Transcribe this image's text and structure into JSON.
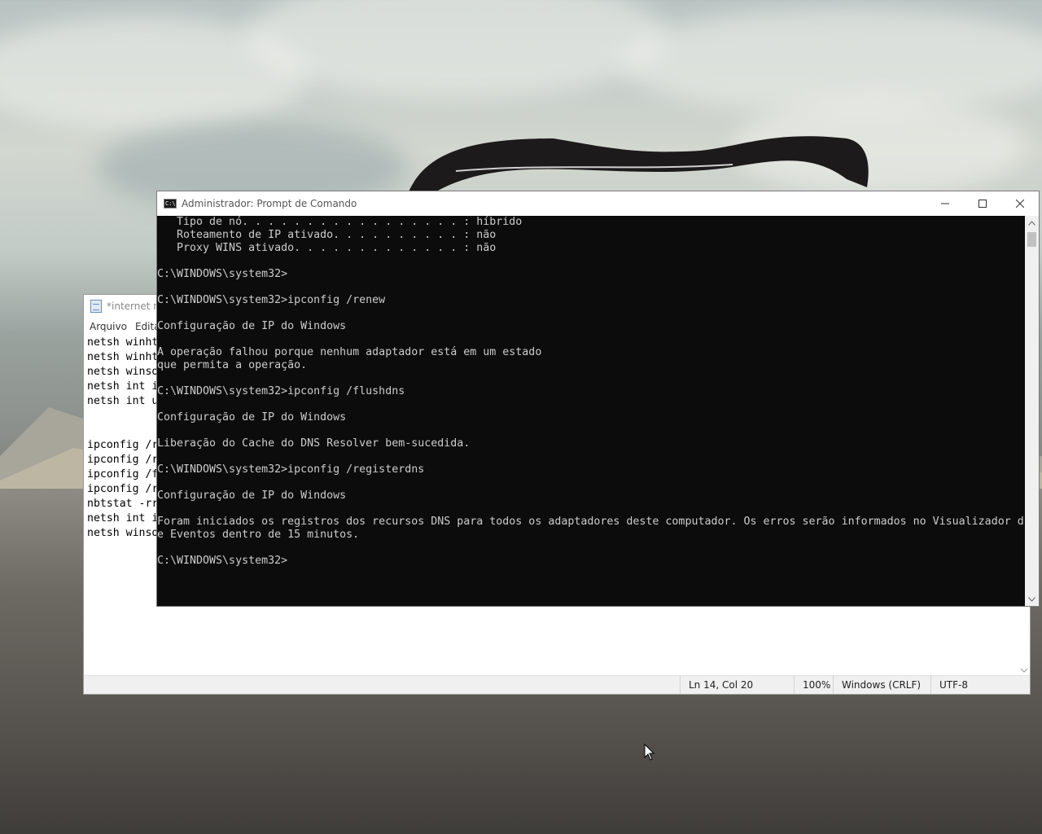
{
  "cmd_window": {
    "title": "Administrador: Prompt de Comando",
    "icon_text": "C:\\.",
    "lines": [
      "   Tipo de nó. . . . . . . . . . . . . . . . . : híbrido",
      "   Roteamento de IP ativado. . . . . . . . . . : não",
      "   Proxy WINS ativado. . . . . . . . . . . . . : não",
      "",
      "C:\\WINDOWS\\system32>",
      "",
      "C:\\WINDOWS\\system32>ipconfig /renew",
      "",
      "Configuração de IP do Windows",
      "",
      "A operação falhou porque nenhum adaptador está em um estado",
      "que permita a operação.",
      "",
      "C:\\WINDOWS\\system32>ipconfig /flushdns",
      "",
      "Configuração de IP do Windows",
      "",
      "Liberação do Cache do DNS Resolver bem-sucedida.",
      "",
      "C:\\WINDOWS\\system32>ipconfig /registerdns",
      "",
      "Configuração de IP do Windows",
      "",
      "Foram iniciados os registros dos recursos DNS para todos os adaptadores deste computador. Os erros serão informados no Visualizador d",
      "e Eventos dentro de 15 minutos.",
      "",
      "C:\\WINDOWS\\system32>"
    ]
  },
  "notepad_window": {
    "title": "*internet na",
    "menu": [
      "Arquivo",
      "Edita"
    ],
    "lines": [
      "netsh winht",
      "netsh winht",
      "netsh winso",
      "netsh int i",
      "netsh int u",
      "",
      "",
      "ipconfig /r",
      "ipconfig /r",
      "ipconfig /f",
      "ipconfig /r",
      "nbtstat -rr",
      "netsh int i",
      "netsh winso"
    ],
    "status": {
      "position": "Ln 14, Col 20",
      "zoom": "100%",
      "line_ending": "Windows (CRLF)",
      "encoding": "UTF-8"
    }
  },
  "icons": {
    "minimize": "minimize-icon",
    "maximize": "maximize-icon",
    "close": "close-icon",
    "cursor": "mouse-pointer-icon"
  }
}
